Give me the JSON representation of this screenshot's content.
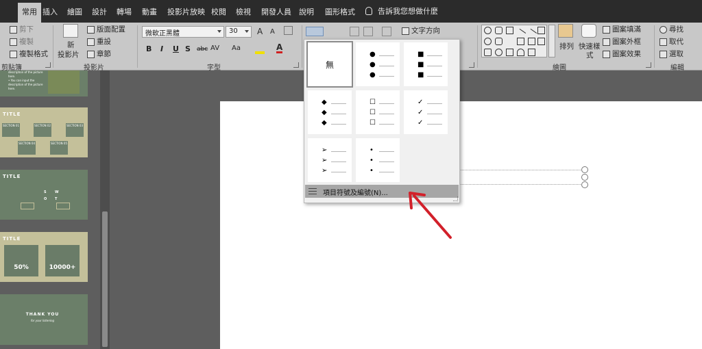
{
  "tabs": [
    {
      "label": "常用",
      "active": true
    },
    {
      "label": "插入"
    },
    {
      "label": "繪圖"
    },
    {
      "label": "設計"
    },
    {
      "label": "轉場"
    },
    {
      "label": "動畫"
    },
    {
      "label": "投影片放映"
    },
    {
      "label": "校閱"
    },
    {
      "label": "檢視"
    },
    {
      "label": "開發人員"
    },
    {
      "label": "說明"
    },
    {
      "label": "圖形格式"
    }
  ],
  "tell_me": "告訴我您想做什麼",
  "ribbon": {
    "clipboard": {
      "cut": "剪下",
      "copy": "複製",
      "format_painter": "複製格式",
      "group": "剪貼簿"
    },
    "slides": {
      "new_slide": "新",
      "new_slide_2": "投影片",
      "layout": "版面配置",
      "reset": "重設",
      "section": "章節",
      "group": "投影片"
    },
    "font": {
      "name": "微軟正黑體",
      "size": "30",
      "grow": "A",
      "shrink": "A",
      "bold": "B",
      "italic": "I",
      "underline": "U",
      "shadow": "S",
      "strike": "abc",
      "spacing": "AV",
      "case": "Aa",
      "group": "字型"
    },
    "paragraph": {
      "text_direction": "文字方向"
    },
    "drawing": {
      "arrange": "排列",
      "quick_styles": "快速樣",
      "quick_styles_2": "式",
      "fill": "圖案填滿",
      "outline": "圖案外框",
      "effects": "圖案效果",
      "group": "繪圖"
    },
    "editing": {
      "find": "尋找",
      "replace": "取代",
      "select": "選取",
      "group": "編輯"
    }
  },
  "bullet_menu": {
    "none_label": "無",
    "options": [
      {
        "name": "none"
      },
      {
        "name": "filled-round",
        "symbol": "●"
      },
      {
        "name": "filled-square",
        "symbol": "■"
      },
      {
        "name": "diamond",
        "symbol": "◆"
      },
      {
        "name": "hollow-square",
        "symbol": "☐"
      },
      {
        "name": "checkmark",
        "symbol": "✓"
      },
      {
        "name": "arrowhead",
        "symbol": "➢"
      },
      {
        "name": "small-round",
        "symbol": "•"
      }
    ],
    "footer_label": "項目符號及編號(N)..."
  },
  "thumbnails": {
    "slide1": {
      "lines": [
        "description of the picture",
        "here.",
        "• You can input the",
        "description of the picture",
        "here."
      ]
    },
    "slide2": {
      "title": "TITLE",
      "sections": [
        "SECTION 01",
        "SECTION 02",
        "SECTION 03",
        "SECTION 04",
        "SECTION 05"
      ]
    },
    "slide3": {
      "title": "TITLE",
      "letters": [
        "S",
        "W",
        "O",
        "T"
      ]
    },
    "slide4": {
      "title": "TITLE",
      "stats": [
        "50%",
        "10000+"
      ]
    },
    "slide5": {
      "title": "THANK YOU",
      "subtitle": "for your listening"
    }
  },
  "colors": {
    "accent_arrow": "#d2202a",
    "thumb_green": "#6b7f69",
    "thumb_tan": "#c4c09a"
  }
}
